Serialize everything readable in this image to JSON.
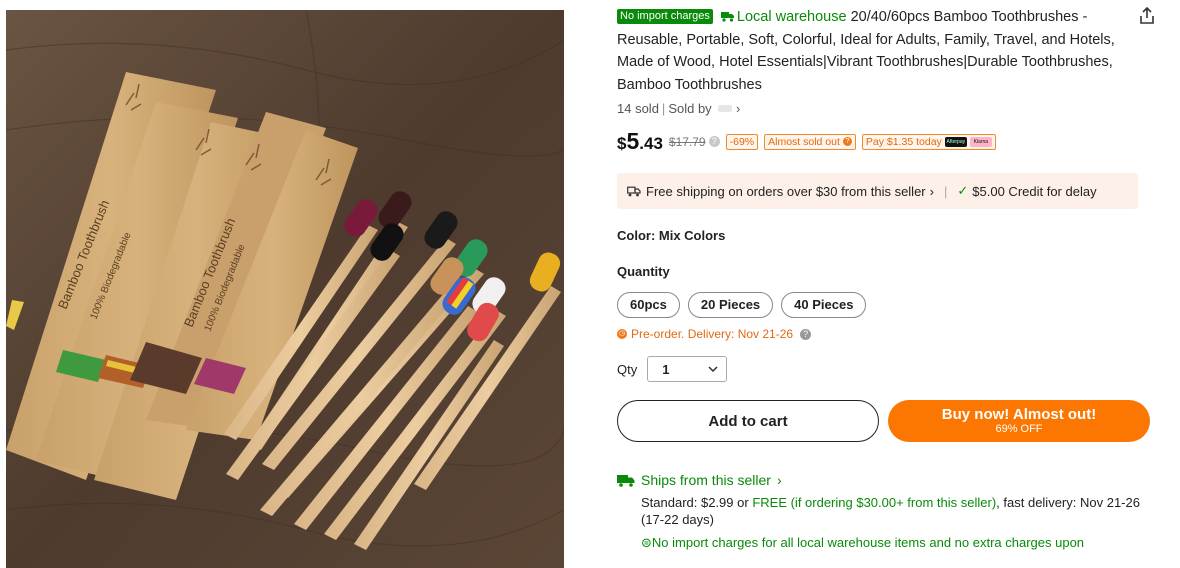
{
  "product": {
    "image_alt": "Bamboo Toothbrush 100% Biodegradable",
    "badge_no_import": "No import charges",
    "local_warehouse": "Local warehouse",
    "title": "20/40/60pcs Bamboo Toothbrushes - Reusable, Portable, Soft, Colorful, Ideal for Adults, Family, Travel, and Hotels, Made of Wood, Hotel Essentials|Vibrant Toothbrushes|Durable Toothbrushes, Bamboo Toothbrushes",
    "sold_count": "14 sold",
    "sold_by": "Sold by"
  },
  "package_text": {
    "brand": "Bamboo Toothbrush",
    "claim": "100% Biodegradable"
  },
  "price": {
    "currency": "$",
    "integer": "5",
    "decimal": ".43",
    "original": "$17.79",
    "discount": "-69%",
    "almost_sold_out": "Almost sold out",
    "pay_today": "Pay $1.35 today",
    "afterpay": "Afterpay",
    "klarna": "Klarna"
  },
  "shipping_bar": {
    "free_shipping": "Free shipping on orders over $30 from this seller",
    "credit": "$5.00 Credit for delay"
  },
  "color": {
    "label": "Color: Mix Colors"
  },
  "quantity": {
    "label": "Quantity",
    "options": [
      "60pcs",
      "20 Pieces",
      "40 Pieces"
    ],
    "preorder": "Pre-order. Delivery: Nov 21-26",
    "qty_label": "Qty",
    "qty_value": "1"
  },
  "buttons": {
    "add_to_cart": "Add to cart",
    "buy_now": "Buy now! Almost out!",
    "buy_now_sub": "69% OFF"
  },
  "ships_from": {
    "label": "Ships from this seller",
    "standard_prefix": "Standard: $2.99 or ",
    "free_text": "FREE (if ordering $30.00+ from this seller)",
    "standard_suffix": ", fast delivery: Nov 21-26 (17-22 days)",
    "no_import": "No import charges for all local warehouse items and no extra charges upon"
  },
  "colors": {
    "accent_orange": "#fb7701",
    "green": "#0a8a0a"
  }
}
